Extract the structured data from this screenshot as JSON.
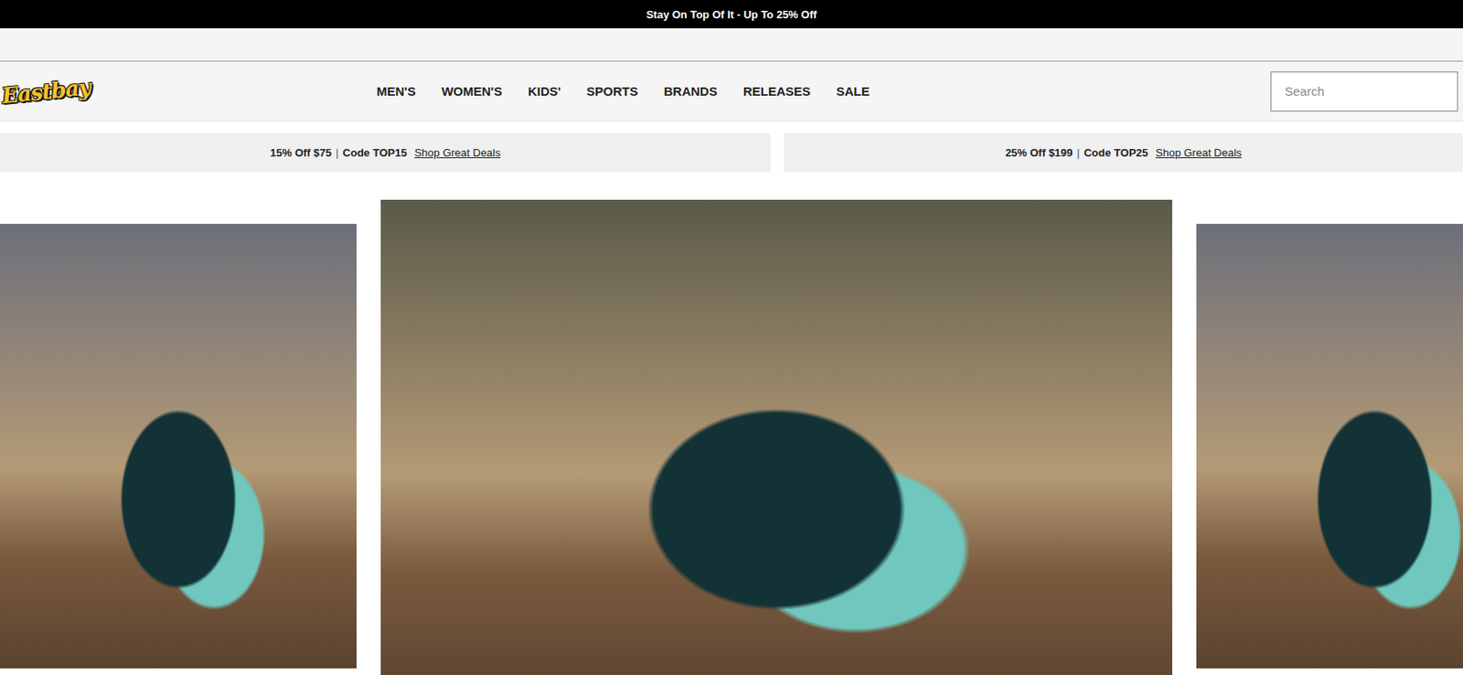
{
  "announcement": "Stay On Top Of It - Up To 25% Off",
  "logo": "Eastbay",
  "nav": [
    "MEN'S",
    "WOMEN'S",
    "KIDS'",
    "SPORTS",
    "BRANDS",
    "RELEASES",
    "SALE"
  ],
  "search": {
    "placeholder": "Search"
  },
  "promos": [
    {
      "offer": "15% Off $75",
      "separator": "|",
      "code": "Code TOP15",
      "link": "Shop Great Deals"
    },
    {
      "offer": "25% Off $199",
      "separator": "|",
      "code": "Code TOP25",
      "link": "Shop Great Deals"
    }
  ],
  "slides": [
    {
      "selected": false
    },
    {
      "selected": true
    },
    {
      "selected": false
    }
  ]
}
